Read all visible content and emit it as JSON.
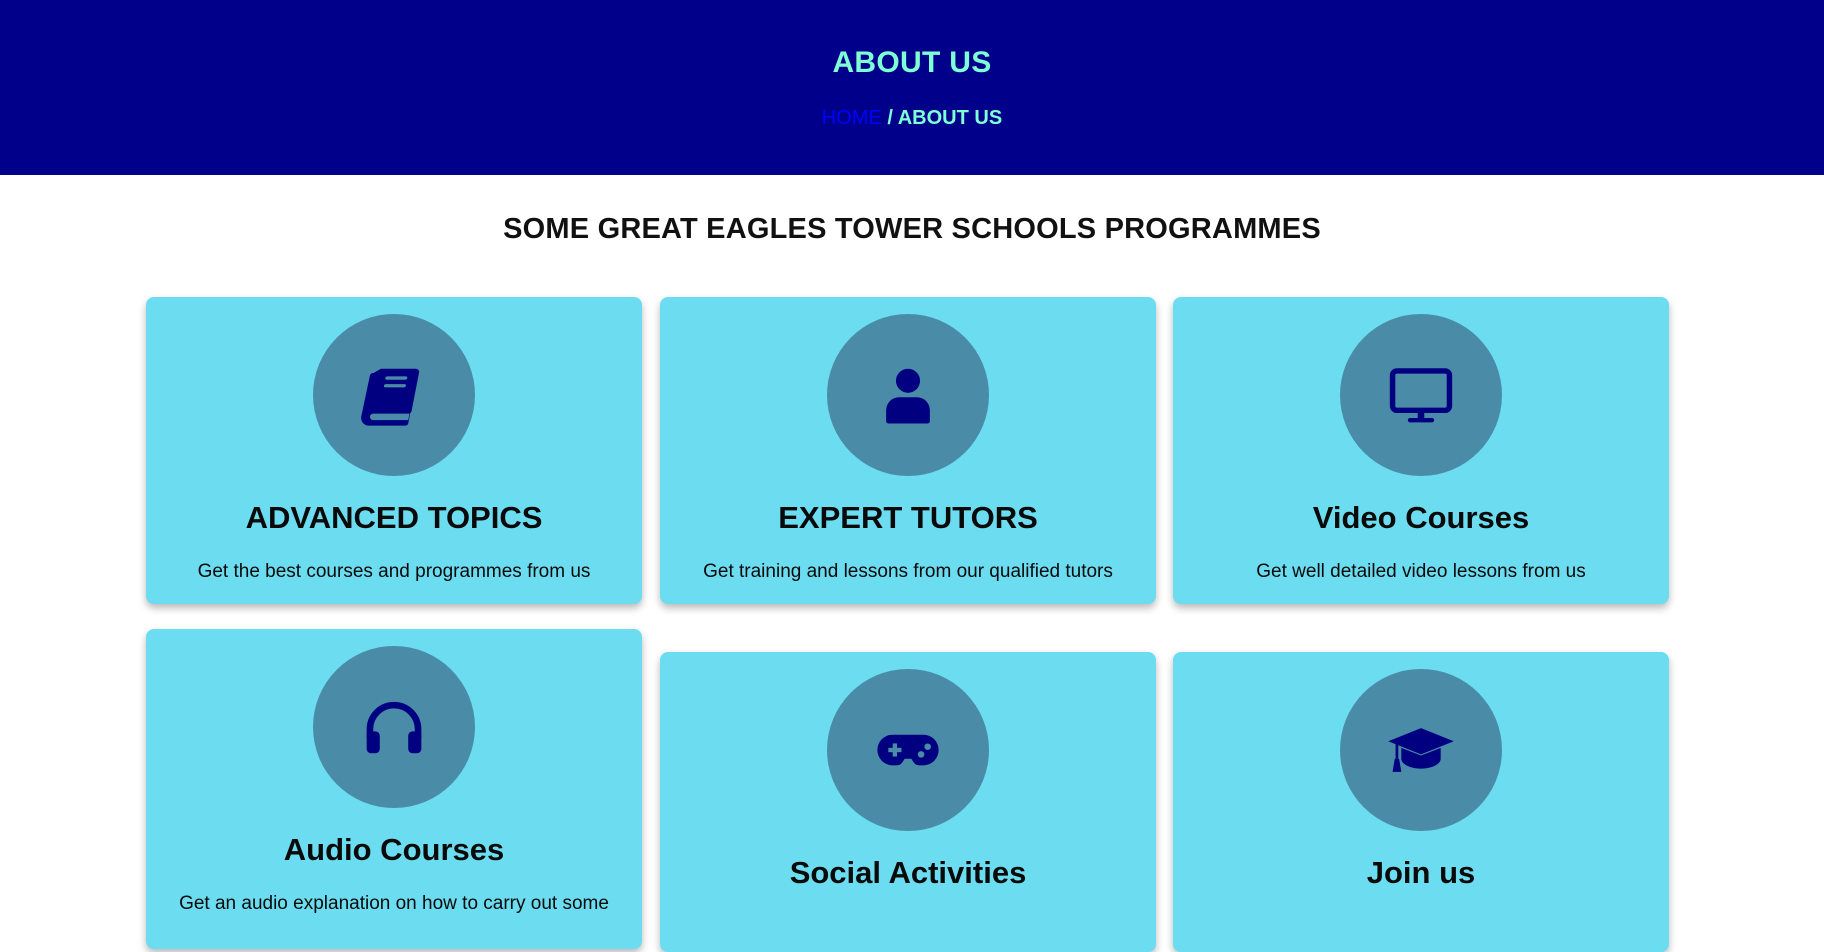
{
  "banner": {
    "title": "ABOUT US",
    "breadcrumb_home": "HOME",
    "breadcrumb_separator": " / ",
    "breadcrumb_current": "ABOUT US"
  },
  "section": {
    "title": "SOME GREAT EAGLES TOWER SCHOOLS PROGRAMMES"
  },
  "cards": [
    {
      "title": "ADVANCED TOPICS",
      "text": "Get the best courses and programmes from us",
      "icon": "book-icon"
    },
    {
      "title": "EXPERT TUTORS",
      "text": "Get training and lessons from our qualified tutors",
      "icon": "user-icon"
    },
    {
      "title": "Video Courses",
      "text": "Get well detailed video lessons from us",
      "icon": "monitor-icon"
    },
    {
      "title": "Audio Courses",
      "text": "Get an audio explanation on how to carry out some",
      "icon": "headphones-icon"
    },
    {
      "title": "Social Activities",
      "text": "",
      "icon": "gamepad-icon"
    },
    {
      "title": "Join us",
      "text": "",
      "icon": "graduation-cap-icon"
    }
  ],
  "colors": {
    "banner_bg": "#00008b",
    "banner_text": "#7fffd4",
    "link": "#0000ff",
    "card_bg": "#6cdcf0",
    "icon_circle": "#4a8ca8",
    "icon_color": "#000080"
  }
}
